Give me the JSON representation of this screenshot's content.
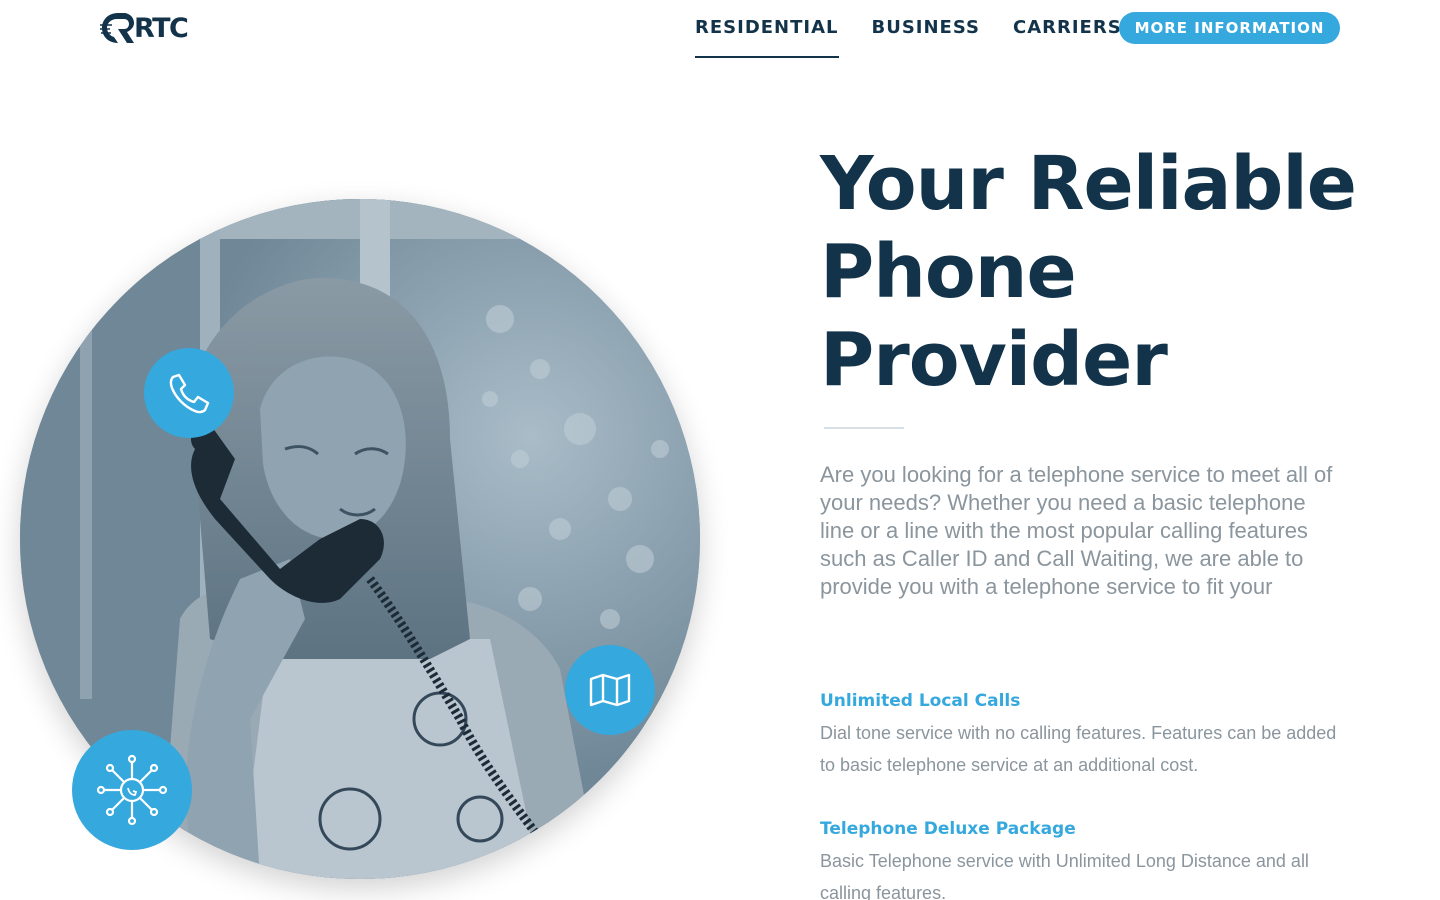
{
  "header": {
    "logo_text": "RTC",
    "nav": [
      {
        "label": "RESIDENTIAL",
        "active": true
      },
      {
        "label": "BUSINESS",
        "active": false
      },
      {
        "label": "CARRIERS",
        "active": false
      }
    ],
    "cta_label": "MORE INFORMATION"
  },
  "hero": {
    "title_lines": [
      "Your Reliable",
      "Phone",
      "Provider"
    ],
    "intro": "Are you looking for a telephone service to meet all of your needs? Whether you need a basic telephone line or a line with the most popular calling features such as Caller ID and Call Waiting, we are able to provide you with a telephone service to fit your",
    "badges": [
      "phone-icon",
      "map-icon",
      "network-icon"
    ]
  },
  "features": [
    {
      "title": "Unlimited Local Calls",
      "description": "Dial tone service with no calling features. Features can be added to basic telephone service at an additional cost."
    },
    {
      "title": "Telephone Deluxe Package",
      "description": "Basic Telephone service with Unlimited Long Distance and all calling features."
    }
  ],
  "colors": {
    "accent": "#35a8de",
    "navy": "#12334a",
    "body_text": "#8a959d"
  }
}
